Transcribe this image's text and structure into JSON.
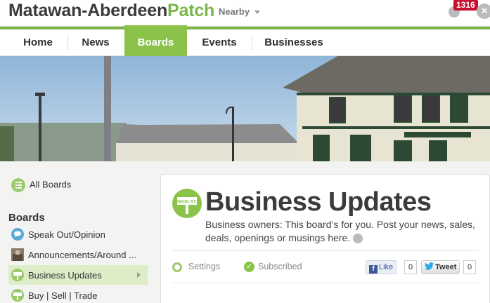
{
  "site": {
    "name_prefix": "Matawan-Aberdeen",
    "name_suffix": "Patch",
    "nearby_label": "Nearby",
    "notification_count": "1316"
  },
  "nav": {
    "items": [
      {
        "label": "Home"
      },
      {
        "label": "News"
      },
      {
        "label": "Boards"
      },
      {
        "label": "Events"
      },
      {
        "label": "Businesses"
      }
    ],
    "active": "Boards"
  },
  "sidebar": {
    "all_boards_label": "All Boards",
    "heading": "Boards",
    "items": [
      {
        "label": "Speak Out/Opinion",
        "icon": "speech-bubble-icon"
      },
      {
        "label": "Announcements/Around ...",
        "icon": "photo-thumbnail-icon"
      },
      {
        "label": "Business Updates",
        "icon": "main-st-sign-icon"
      },
      {
        "label": "Buy | Sell | Trade",
        "icon": "photo-thumbnail-icon"
      }
    ]
  },
  "board": {
    "title": "Business Updates",
    "icon_text": "MAIN ST.",
    "description": "Business owners: This board’s for you. Post your news, sales, deals, openings or musings here.",
    "settings_label": "Settings",
    "subscribed_label": "Subscribed",
    "like_label": "Like",
    "like_count": "0",
    "tweet_label": "Tweet",
    "tweet_count": "0"
  },
  "colors": {
    "accent": "#7ab648",
    "active_nav": "#8bc34a",
    "badge": "#c8102e"
  }
}
